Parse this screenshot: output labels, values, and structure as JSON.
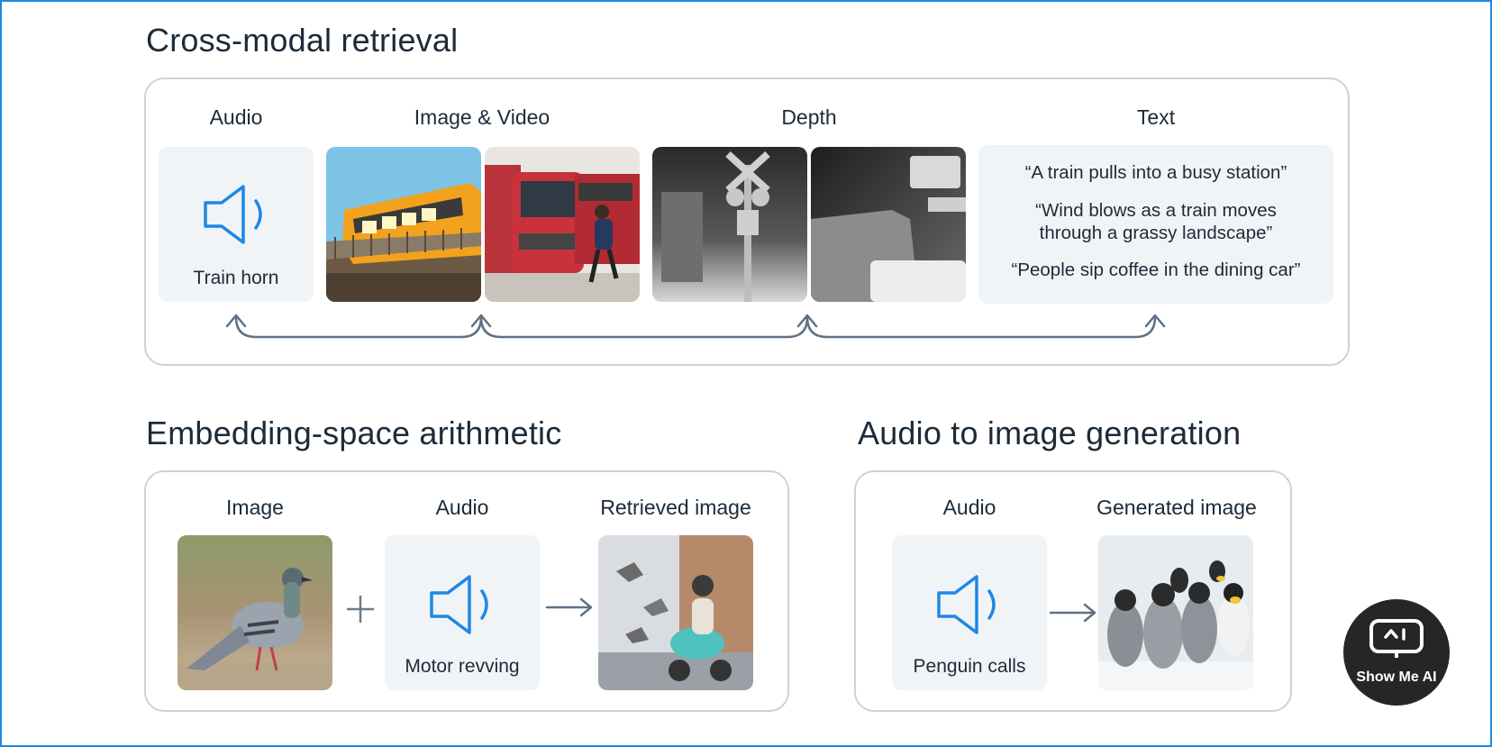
{
  "cross_modal": {
    "title": "Cross-modal retrieval",
    "labels": {
      "audio": "Audio",
      "image_video": "Image & Video",
      "depth": "Depth",
      "text": "Text"
    },
    "audio_caption": "Train horn",
    "text_quotes": [
      "“A train pulls into a busy station”",
      "“Wind blows as a train moves",
      "through a grassy landscape”",
      "“People sip coffee in the dining car”"
    ]
  },
  "arithmetic": {
    "title": "Embedding-space arithmetic",
    "labels": {
      "image": "Image",
      "audio": "Audio",
      "retrieved": "Retrieved image"
    },
    "audio_caption": "Motor revving",
    "operator_plus": "+"
  },
  "generation": {
    "title": "Audio to image generation",
    "labels": {
      "audio": "Audio",
      "generated": "Generated image"
    },
    "audio_caption": "Penguin calls"
  },
  "badge": {
    "text": "Show Me AI"
  },
  "colors": {
    "accent_blue": "#1e88e5",
    "panel_border": "#c9d3dd",
    "tile_bg": "#f1f4f7",
    "arrow_gray": "#5f7183"
  }
}
